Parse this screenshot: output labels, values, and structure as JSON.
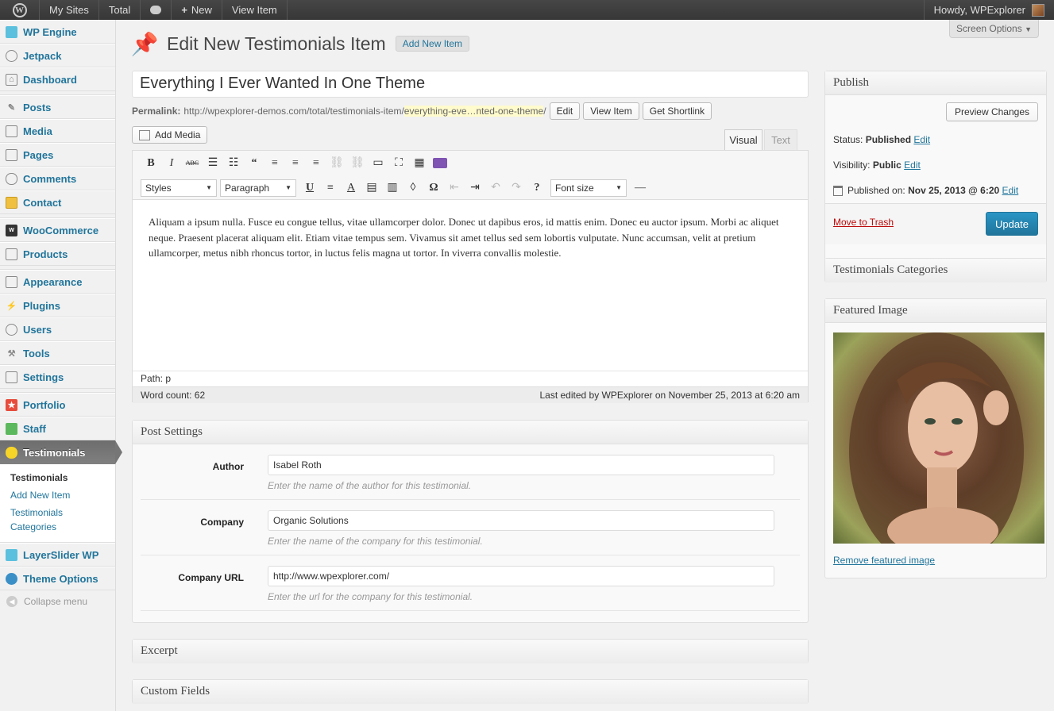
{
  "admin_bar": {
    "my_sites": "My Sites",
    "site": "Total",
    "new": "New",
    "view_item": "View Item",
    "howdy": "Howdy, WPExplorer"
  },
  "sidebar": {
    "items": [
      {
        "label": "WP Engine",
        "icon": "wpengine-icon"
      },
      {
        "label": "Jetpack",
        "icon": "jetpack-icon"
      },
      {
        "label": "Dashboard",
        "icon": "dashboard-icon"
      },
      {
        "label": "Posts",
        "icon": "pin-icon"
      },
      {
        "label": "Media",
        "icon": "media-icon"
      },
      {
        "label": "Pages",
        "icon": "pages-icon"
      },
      {
        "label": "Comments",
        "icon": "comments-icon"
      },
      {
        "label": "Contact",
        "icon": "contact-icon"
      },
      {
        "label": "WooCommerce",
        "icon": "woocommerce-icon"
      },
      {
        "label": "Products",
        "icon": "cart-icon"
      },
      {
        "label": "Appearance",
        "icon": "appearance-icon"
      },
      {
        "label": "Plugins",
        "icon": "plugins-icon"
      },
      {
        "label": "Users",
        "icon": "users-icon"
      },
      {
        "label": "Tools",
        "icon": "tools-icon"
      },
      {
        "label": "Settings",
        "icon": "settings-icon"
      },
      {
        "label": "Portfolio",
        "icon": "star-icon"
      },
      {
        "label": "Staff",
        "icon": "staff-icon"
      },
      {
        "label": "Testimonials",
        "icon": "testimonials-icon"
      },
      {
        "label": "LayerSlider WP",
        "icon": "layerslider-icon"
      },
      {
        "label": "Theme Options",
        "icon": "theme-options-icon"
      }
    ],
    "submenu": [
      "Testimonials",
      "Add New Item",
      "Testimonials Categories"
    ],
    "collapse": "Collapse menu"
  },
  "screen_options": "Screen Options",
  "page_title": "Edit New Testimonials Item",
  "add_new": "Add New Item",
  "post_title": "Everything I Ever Wanted In One Theme",
  "permalink": {
    "label": "Permalink:",
    "base": "http://wpexplorer-demos.com/total/testimonials-item/",
    "slug": "everything-eve…nted-one-theme",
    "tail": "/",
    "edit": "Edit",
    "view": "View Item",
    "shortlink": "Get Shortlink"
  },
  "editor": {
    "add_media": "Add Media",
    "tab_visual": "Visual",
    "tab_text": "Text",
    "styles": "Styles",
    "paragraph": "Paragraph",
    "font_size": "Font size",
    "content": "Aliquam a ipsum nulla. Fusce eu congue tellus, vitae ullamcorper dolor. Donec ut dapibus eros, id mattis enim. Donec eu auctor ipsum. Morbi ac aliquet neque. Praesent placerat aliquam elit. Etiam vitae tempus sem. Vivamus sit amet tellus sed sem lobortis vulputate. Nunc accumsan, velit at pretium ullamcorper, metus nibh rhoncus tortor, in luctus felis magna ut tortor. In viverra convallis molestie.",
    "path": "Path: p",
    "word_count": "Word count: 62",
    "last_edited": "Last edited by WPExplorer on November 25, 2013 at 6:20 am"
  },
  "post_settings": {
    "title": "Post Settings",
    "fields": [
      {
        "label": "Author",
        "value": "Isabel Roth",
        "hint": "Enter the name of the author for this testimonial."
      },
      {
        "label": "Company",
        "value": "Organic Solutions",
        "hint": "Enter the name of the company for this testimonial."
      },
      {
        "label": "Company URL",
        "value": "http://www.wpexplorer.com/",
        "hint": "Enter the url for the company for this testimonial."
      }
    ]
  },
  "excerpt": "Excerpt",
  "custom_fields": "Custom Fields",
  "publish": {
    "title": "Publish",
    "preview": "Preview Changes",
    "status_label": "Status:",
    "status": "Published",
    "visibility_label": "Visibility:",
    "visibility": "Public",
    "published_label": "Published on:",
    "published": "Nov 25, 2013 @ 6:20",
    "edit": "Edit",
    "trash": "Move to Trash",
    "update": "Update"
  },
  "categories": "Testimonials Categories",
  "featured": {
    "title": "Featured Image",
    "remove": "Remove featured image"
  },
  "colors": {
    "link": "#21759b",
    "trash": "#bc0b0b",
    "update": "#2a95c5"
  }
}
